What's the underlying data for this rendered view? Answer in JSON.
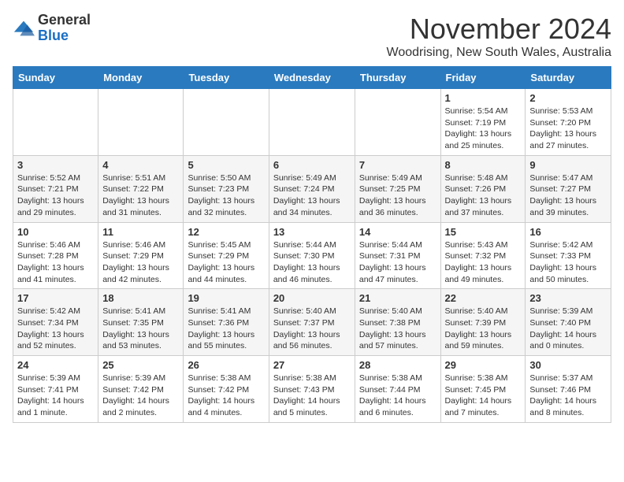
{
  "logo": {
    "general": "General",
    "blue": "Blue"
  },
  "header": {
    "month_year": "November 2024",
    "location": "Woodrising, New South Wales, Australia"
  },
  "weekdays": [
    "Sunday",
    "Monday",
    "Tuesday",
    "Wednesday",
    "Thursday",
    "Friday",
    "Saturday"
  ],
  "weeks": [
    [
      {
        "day": "",
        "info": ""
      },
      {
        "day": "",
        "info": ""
      },
      {
        "day": "",
        "info": ""
      },
      {
        "day": "",
        "info": ""
      },
      {
        "day": "",
        "info": ""
      },
      {
        "day": "1",
        "info": "Sunrise: 5:54 AM\nSunset: 7:19 PM\nDaylight: 13 hours\nand 25 minutes."
      },
      {
        "day": "2",
        "info": "Sunrise: 5:53 AM\nSunset: 7:20 PM\nDaylight: 13 hours\nand 27 minutes."
      }
    ],
    [
      {
        "day": "3",
        "info": "Sunrise: 5:52 AM\nSunset: 7:21 PM\nDaylight: 13 hours\nand 29 minutes."
      },
      {
        "day": "4",
        "info": "Sunrise: 5:51 AM\nSunset: 7:22 PM\nDaylight: 13 hours\nand 31 minutes."
      },
      {
        "day": "5",
        "info": "Sunrise: 5:50 AM\nSunset: 7:23 PM\nDaylight: 13 hours\nand 32 minutes."
      },
      {
        "day": "6",
        "info": "Sunrise: 5:49 AM\nSunset: 7:24 PM\nDaylight: 13 hours\nand 34 minutes."
      },
      {
        "day": "7",
        "info": "Sunrise: 5:49 AM\nSunset: 7:25 PM\nDaylight: 13 hours\nand 36 minutes."
      },
      {
        "day": "8",
        "info": "Sunrise: 5:48 AM\nSunset: 7:26 PM\nDaylight: 13 hours\nand 37 minutes."
      },
      {
        "day": "9",
        "info": "Sunrise: 5:47 AM\nSunset: 7:27 PM\nDaylight: 13 hours\nand 39 minutes."
      }
    ],
    [
      {
        "day": "10",
        "info": "Sunrise: 5:46 AM\nSunset: 7:28 PM\nDaylight: 13 hours\nand 41 minutes."
      },
      {
        "day": "11",
        "info": "Sunrise: 5:46 AM\nSunset: 7:29 PM\nDaylight: 13 hours\nand 42 minutes."
      },
      {
        "day": "12",
        "info": "Sunrise: 5:45 AM\nSunset: 7:29 PM\nDaylight: 13 hours\nand 44 minutes."
      },
      {
        "day": "13",
        "info": "Sunrise: 5:44 AM\nSunset: 7:30 PM\nDaylight: 13 hours\nand 46 minutes."
      },
      {
        "day": "14",
        "info": "Sunrise: 5:44 AM\nSunset: 7:31 PM\nDaylight: 13 hours\nand 47 minutes."
      },
      {
        "day": "15",
        "info": "Sunrise: 5:43 AM\nSunset: 7:32 PM\nDaylight: 13 hours\nand 49 minutes."
      },
      {
        "day": "16",
        "info": "Sunrise: 5:42 AM\nSunset: 7:33 PM\nDaylight: 13 hours\nand 50 minutes."
      }
    ],
    [
      {
        "day": "17",
        "info": "Sunrise: 5:42 AM\nSunset: 7:34 PM\nDaylight: 13 hours\nand 52 minutes."
      },
      {
        "day": "18",
        "info": "Sunrise: 5:41 AM\nSunset: 7:35 PM\nDaylight: 13 hours\nand 53 minutes."
      },
      {
        "day": "19",
        "info": "Sunrise: 5:41 AM\nSunset: 7:36 PM\nDaylight: 13 hours\nand 55 minutes."
      },
      {
        "day": "20",
        "info": "Sunrise: 5:40 AM\nSunset: 7:37 PM\nDaylight: 13 hours\nand 56 minutes."
      },
      {
        "day": "21",
        "info": "Sunrise: 5:40 AM\nSunset: 7:38 PM\nDaylight: 13 hours\nand 57 minutes."
      },
      {
        "day": "22",
        "info": "Sunrise: 5:40 AM\nSunset: 7:39 PM\nDaylight: 13 hours\nand 59 minutes."
      },
      {
        "day": "23",
        "info": "Sunrise: 5:39 AM\nSunset: 7:40 PM\nDaylight: 14 hours\nand 0 minutes."
      }
    ],
    [
      {
        "day": "24",
        "info": "Sunrise: 5:39 AM\nSunset: 7:41 PM\nDaylight: 14 hours\nand 1 minute."
      },
      {
        "day": "25",
        "info": "Sunrise: 5:39 AM\nSunset: 7:42 PM\nDaylight: 14 hours\nand 2 minutes."
      },
      {
        "day": "26",
        "info": "Sunrise: 5:38 AM\nSunset: 7:42 PM\nDaylight: 14 hours\nand 4 minutes."
      },
      {
        "day": "27",
        "info": "Sunrise: 5:38 AM\nSunset: 7:43 PM\nDaylight: 14 hours\nand 5 minutes."
      },
      {
        "day": "28",
        "info": "Sunrise: 5:38 AM\nSunset: 7:44 PM\nDaylight: 14 hours\nand 6 minutes."
      },
      {
        "day": "29",
        "info": "Sunrise: 5:38 AM\nSunset: 7:45 PM\nDaylight: 14 hours\nand 7 minutes."
      },
      {
        "day": "30",
        "info": "Sunrise: 5:37 AM\nSunset: 7:46 PM\nDaylight: 14 hours\nand 8 minutes."
      }
    ]
  ]
}
